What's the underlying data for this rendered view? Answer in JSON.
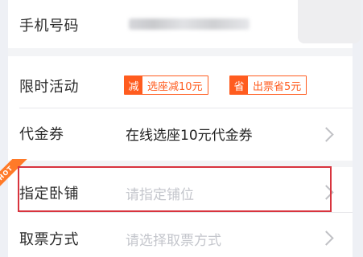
{
  "phone_row": {
    "label": "手机号码"
  },
  "promo_row": {
    "label": "限时活动",
    "badges": [
      {
        "tag": "减",
        "text": "选座减10元"
      },
      {
        "tag": "省",
        "text": "出票省5元"
      }
    ]
  },
  "voucher_row": {
    "label": "代金券",
    "value": "在线选座10元代金券"
  },
  "berth_row": {
    "label": "指定卧铺",
    "placeholder": "请指定铺位",
    "ribbon": "HOT"
  },
  "ticket_row": {
    "label": "取票方式",
    "placeholder": "请选择取票方式"
  },
  "colors": {
    "accent": "#ff5c1f",
    "highlight_border": "#d8343e",
    "ribbon": "#ff7a28"
  },
  "icons": [
    "chevron-right-icon",
    "avatar-placeholder"
  ]
}
